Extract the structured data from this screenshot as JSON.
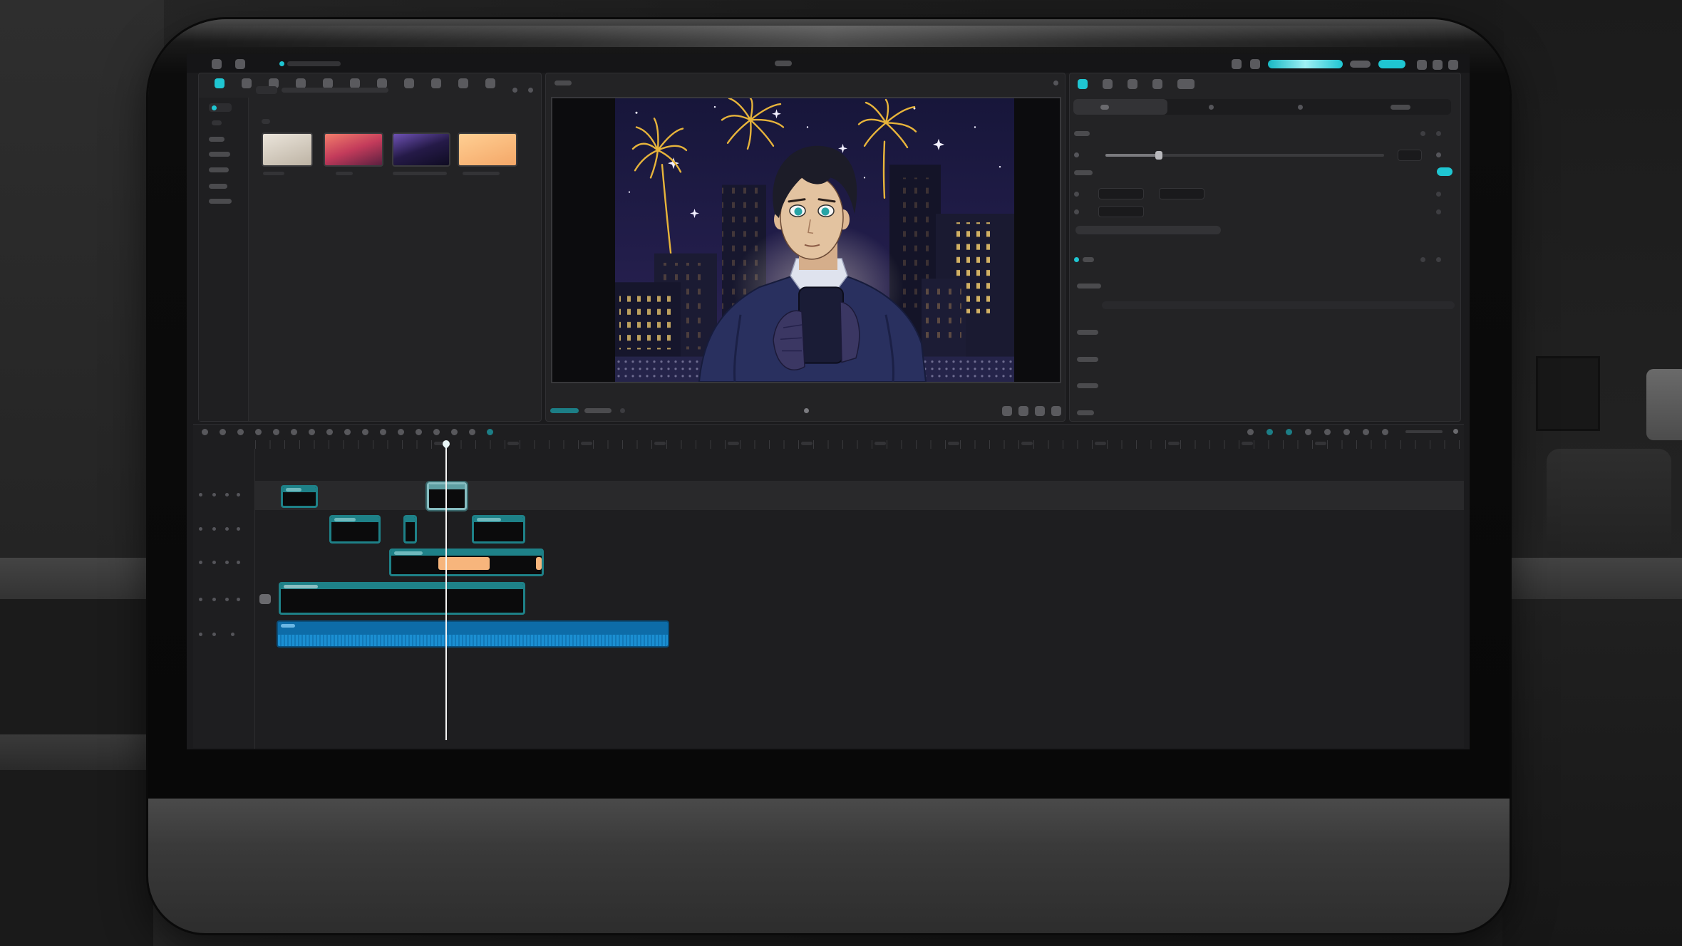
{
  "theme": {
    "accent": "#1fc6d2",
    "accent_deep": "#1c7e86",
    "panel": "#232325",
    "panel_border": "#303033",
    "screen": "#1b1b1d",
    "clip_outline": "#1e8188",
    "clip_highlight": "#f7b57c",
    "audio_clip": "#0d6ca8",
    "audio_wave": "#1b8fd2",
    "playhead": "#f4f4f4"
  },
  "top_bar": {
    "left_icons": [
      {
        "icon": "app-logo-icon"
      },
      {
        "icon": "menu-icon"
      }
    ],
    "right_icons": [
      {
        "icon": "feedback-icon"
      },
      {
        "icon": "cloud-sync-icon"
      }
    ],
    "window_icons": [
      {
        "icon": "minimize-icon"
      },
      {
        "icon": "maximize-icon"
      },
      {
        "icon": "close-icon"
      }
    ]
  },
  "media_panel": {
    "tool_icons": [
      {
        "icon": "media-icon",
        "active": true
      },
      {
        "icon": "audio-icon"
      },
      {
        "icon": "text-icon"
      },
      {
        "icon": "stickers-icon"
      },
      {
        "icon": "effects-icon"
      },
      {
        "icon": "transitions-icon"
      },
      {
        "icon": "captions-icon"
      },
      {
        "icon": "filters-icon"
      },
      {
        "icon": "adjustment-icon"
      },
      {
        "icon": "templates-icon"
      },
      {
        "icon": "ai-tools-icon"
      }
    ],
    "thumbnails": [
      {
        "colors": [
          "#ebe5db",
          "#bdb3a4"
        ]
      },
      {
        "colors": [
          "#f27d6b",
          "#c33b5b",
          "#5c2040"
        ]
      },
      {
        "colors": [
          "#6e52b4",
          "#251a48",
          "#0f0c22"
        ]
      },
      {
        "colors": [
          "#ffcf93",
          "#f4a768"
        ]
      }
    ]
  },
  "preview_panel": {
    "control_icons": [
      {
        "icon": "ratio-icon"
      },
      {
        "icon": "zoom-icon"
      },
      {
        "icon": "fullscreen-icon"
      },
      {
        "icon": "more-icon"
      }
    ]
  },
  "inspector": {
    "tab_icons": [
      {
        "icon": "video-tab-icon",
        "active": true
      },
      {
        "icon": "audio-tab-icon"
      },
      {
        "icon": "speed-tab-icon"
      },
      {
        "icon": "animation-tab-icon"
      },
      {
        "icon": "adjust-tab-icon"
      }
    ]
  },
  "timeline": {
    "left_tools": [
      {
        "icon": "select-tool-icon"
      },
      {
        "icon": "undo-icon"
      },
      {
        "icon": "redo-icon"
      },
      {
        "icon": "split-icon"
      },
      {
        "icon": "split-left-icon"
      },
      {
        "icon": "split-right-icon"
      },
      {
        "icon": "delete-icon"
      },
      {
        "icon": "freeze-icon"
      },
      {
        "icon": "reverse-icon"
      },
      {
        "icon": "mirror-icon"
      },
      {
        "icon": "rotate-icon"
      },
      {
        "icon": "crop-icon"
      },
      {
        "icon": "marker-icon"
      },
      {
        "icon": "speed-icon"
      },
      {
        "icon": "mask-icon"
      },
      {
        "icon": "keyframe-icon"
      },
      {
        "icon": "ai-edit-icon",
        "active": true
      }
    ],
    "right_tools": [
      {
        "icon": "record-icon"
      },
      {
        "icon": "main-track-magnet-icon",
        "active": true
      },
      {
        "icon": "auto-snap-icon",
        "active": true
      },
      {
        "icon": "linkage-icon"
      },
      {
        "icon": "preview-axis-icon"
      },
      {
        "icon": "zoom-out-icon"
      },
      {
        "icon": "zoom-fit-icon"
      },
      {
        "icon": "zoom-in-icon"
      }
    ]
  }
}
